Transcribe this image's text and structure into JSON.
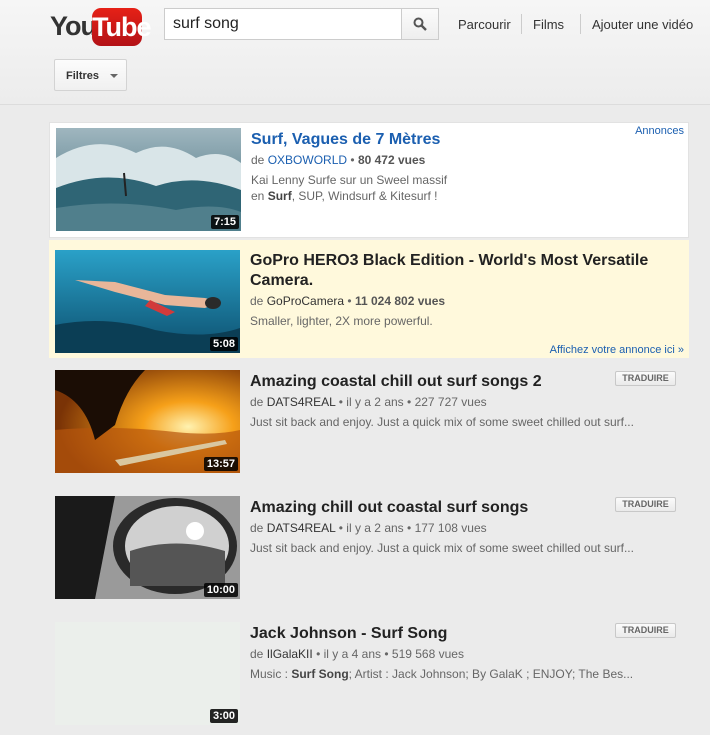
{
  "header": {
    "logo_you": "You",
    "logo_tube": "Tube",
    "search_value": "surf song",
    "nav": [
      "Parcourir",
      "Films",
      "Ajouter une vidéo"
    ],
    "filter_label": "Filtres"
  },
  "ads_label": "Annonces",
  "ad_link": "Affichez votre annonce ici »",
  "translate_label": "TRADUIRE",
  "results": [
    {
      "title": "Surf, Vagues de 7 Mètres",
      "by": "de",
      "channel": "OXBOWORLD",
      "views": "80 472 vues",
      "desc1": "Kai Lenny Surfe sur un Sweel massif",
      "desc2_pre": "en ",
      "desc2_bold": "Surf",
      "desc2_post": ", SUP, Windsurf & Kitesurf !",
      "duration": "7:15"
    },
    {
      "title": "GoPro HERO3 Black Edition - World's Most Versatile Camera.",
      "by": "de",
      "channel": "GoProCamera",
      "views": "11 024 802 vues",
      "desc": "Smaller, lighter, 2X more powerful.",
      "duration": "5:08"
    },
    {
      "title": "Amazing coastal chill out surf songs 2",
      "by": "de",
      "channel": "DATS4REAL",
      "age": "il y a 2 ans",
      "views": "227 727 vues",
      "desc": "Just sit back and enjoy. Just a quick mix of some sweet chilled out surf...",
      "duration": "13:57"
    },
    {
      "title": "Amazing chill out coastal surf songs",
      "by": "de",
      "channel": "DATS4REAL",
      "age": "il y a 2 ans",
      "views": "177 108 vues",
      "desc": "Just sit back and enjoy. Just a quick mix of some sweet chilled out surf...",
      "duration": "10:00"
    },
    {
      "title": "Jack Johnson - Surf Song",
      "by": "de",
      "channel": "IlGalaKII",
      "age": "il y a 4 ans",
      "views": "519 568 vues",
      "desc_pre": "Music : ",
      "desc_bold": "Surf Song",
      "desc_post": "; Artist : Jack Johnson; By GalaK ; ENJOY; The Bes...",
      "duration": "3:00"
    }
  ],
  "dot": "•"
}
